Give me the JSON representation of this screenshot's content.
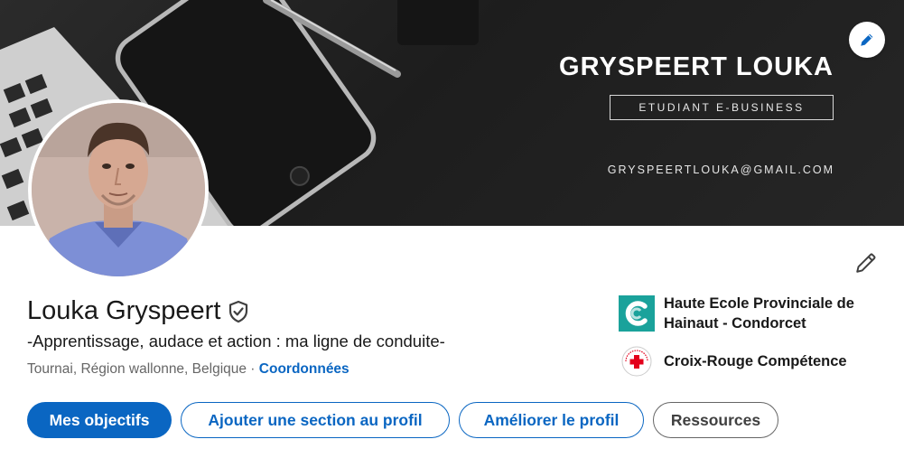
{
  "banner": {
    "name": "GRYSPEERT LOUKA",
    "role": "ETUDIANT E-BUSINESS",
    "email": "GRYSPEERTLOUKA@GMAIL.COM",
    "edit_icon": "pencil-icon"
  },
  "profile": {
    "name": "Louka Gryspeert",
    "verified_icon": "shield-check-icon",
    "headline": "-Apprentissage, audace et action : ma ligne de conduite-",
    "location": "Tournai, Région wallonne, Belgique",
    "separator": " · ",
    "contact_link": "Coordonnées",
    "edit_icon": "pencil-icon"
  },
  "organizations": [
    {
      "name": "Haute Ecole Provinciale de Hainaut - Condorcet",
      "logo": "condorcet-logo"
    },
    {
      "name": "Croix-Rouge Compétence",
      "logo": "croix-rouge-logo"
    }
  ],
  "actions": {
    "goals": "Mes objectifs",
    "add_section": "Ajouter une section au profil",
    "improve": "Améliorer le profil",
    "resources": "Ressources"
  },
  "colors": {
    "primary": "#0a66c2",
    "text": "#191919",
    "muted": "#666666",
    "condorcet": "#1aa29b",
    "red_cross": "#e3001b"
  }
}
